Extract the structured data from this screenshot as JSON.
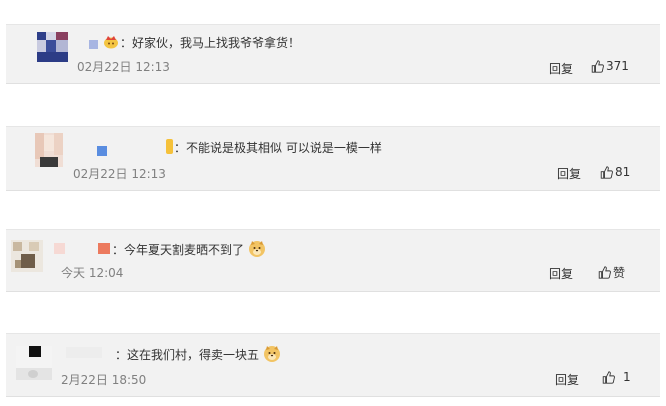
{
  "comments": [
    {
      "text": "：好家伙，我马上找我爷爷拿货！",
      "time": "02月22日 12:13",
      "reply_label": "回复",
      "like_count": "371"
    },
    {
      "text": "：不能说是极其相似 可以说是一模一样",
      "time": "02月22日 12:13",
      "reply_label": "回复",
      "like_count": "81"
    },
    {
      "text": "：今年夏天割麦晒不到了",
      "time": "今天 12:04",
      "reply_label": "回复",
      "like_count": "赞"
    },
    {
      "text": "：这在我们村，得卖一块五",
      "time": "2月22日 18:50",
      "reply_label": "回复",
      "like_count": "1"
    }
  ],
  "icons": {
    "like": "thumbs-up-icon",
    "emoji": "doge-emoji-icon",
    "badge": "crown-badge-icon"
  },
  "colors": {
    "card_bg": "#f2f2f2",
    "time": "#808080",
    "text": "#333333"
  }
}
